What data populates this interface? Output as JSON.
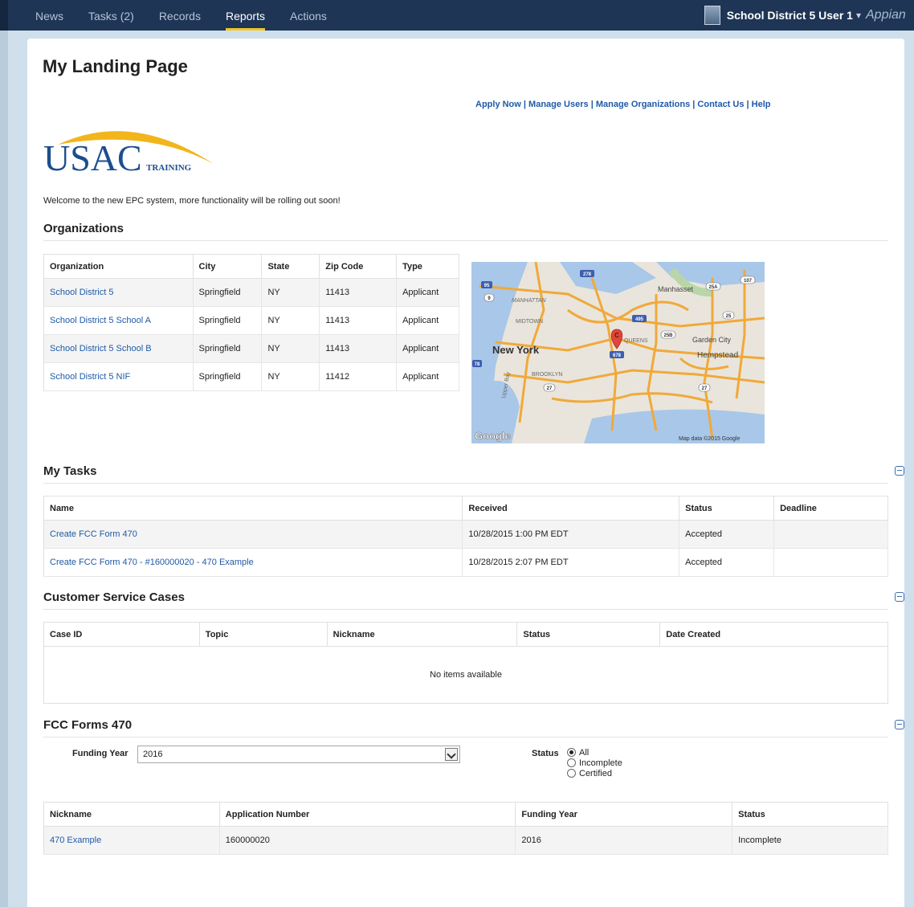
{
  "nav": {
    "items": [
      {
        "label": "News"
      },
      {
        "label": "Tasks (2)"
      },
      {
        "label": "Records"
      },
      {
        "label": "Reports"
      },
      {
        "label": "Actions"
      }
    ],
    "active": "Reports",
    "user": "School District 5 User 1",
    "caret": "▾",
    "brand": "Appian"
  },
  "page": {
    "title": "My Landing Page",
    "links": [
      "Apply Now",
      "Manage Users",
      "Manage Organizations",
      "Contact Us",
      "Help"
    ],
    "link_sep": " | ",
    "logo_main": "USAC",
    "logo_sub": "TRAINING",
    "welcome": "Welcome to the new EPC system, more functionality will be rolling out soon!"
  },
  "organizations": {
    "title": "Organizations",
    "headers": [
      "Organization",
      "City",
      "State",
      "Zip Code",
      "Type"
    ],
    "rows": [
      [
        "School District 5",
        "Springfield",
        "NY",
        "11413",
        "Applicant"
      ],
      [
        "School District 5 School A",
        "Springfield",
        "NY",
        "11413",
        "Applicant"
      ],
      [
        "School District 5 School B",
        "Springfield",
        "NY",
        "11413",
        "Applicant"
      ],
      [
        "School District 5 NIF",
        "Springfield",
        "NY",
        "11412",
        "Applicant"
      ]
    ]
  },
  "map": {
    "labels": {
      "manhattan": "MANHATTAN",
      "midtown": "MIDTOWN",
      "new_york": "New York",
      "brooklyn": "BROOKLYN",
      "queens": "QUEENS",
      "manhasset": "Manhasset",
      "garden_city": "Garden City",
      "hempstead": "Hempstead",
      "upper_bay": "Upper Bay",
      "google": "Google",
      "attribution": "Map data ©2015 Google",
      "marker": "C"
    },
    "shields": [
      "95",
      "278",
      "495",
      "25A",
      "107",
      "25",
      "25B",
      "678",
      "27",
      "78",
      "9"
    ]
  },
  "tasks": {
    "title": "My Tasks",
    "headers": [
      "Name",
      "Received",
      "Status",
      "Deadline"
    ],
    "rows": [
      [
        "Create FCC Form 470",
        "10/28/2015 1:00 PM EDT",
        "Accepted",
        ""
      ],
      [
        "Create FCC Form 470 - #160000020 - 470 Example",
        "10/28/2015 2:07 PM EDT",
        "Accepted",
        ""
      ]
    ]
  },
  "cases": {
    "title": "Customer Service Cases",
    "headers": [
      "Case ID",
      "Topic",
      "Nickname",
      "Status",
      "Date Created"
    ],
    "empty": "No items available"
  },
  "forms470": {
    "title": "FCC Forms 470",
    "funding_year_label": "Funding Year",
    "funding_year_value": "2016",
    "status_label": "Status",
    "status_options": [
      "All",
      "Incomplete",
      "Certified"
    ],
    "status_selected": "All",
    "headers": [
      "Nickname",
      "Application Number",
      "Funding Year",
      "Status"
    ],
    "rows": [
      [
        "470 Example",
        "160000020",
        "2016",
        "Incomplete"
      ]
    ]
  }
}
